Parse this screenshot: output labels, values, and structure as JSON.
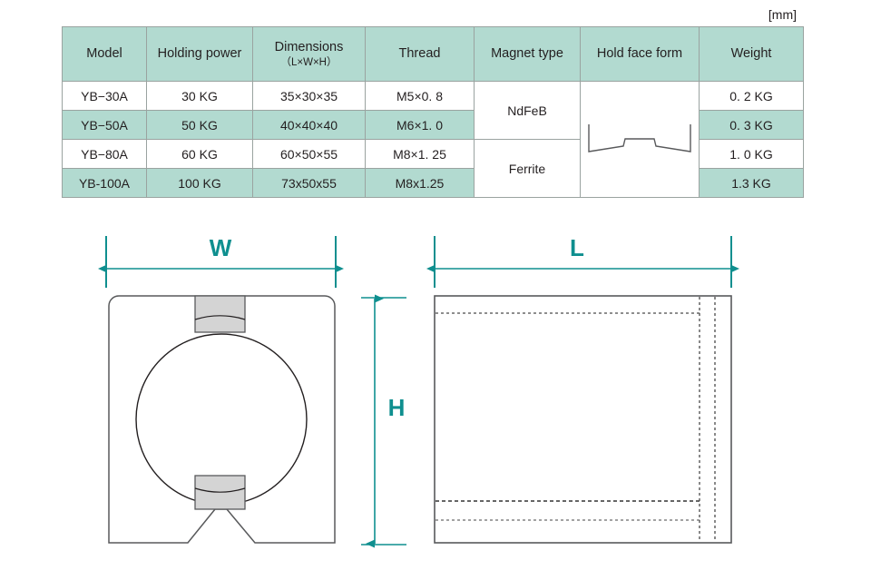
{
  "unit_note": "[mm]",
  "table": {
    "headers": [
      {
        "label": "Model",
        "sub": ""
      },
      {
        "label": "Holding power",
        "sub": ""
      },
      {
        "label": "Dimensions",
        "sub": "（L×W×H）"
      },
      {
        "label": "Thread",
        "sub": ""
      },
      {
        "label": "Magnet type",
        "sub": ""
      },
      {
        "label": "Hold face form",
        "sub": ""
      },
      {
        "label": "Weight",
        "sub": ""
      }
    ],
    "rows": [
      {
        "model": "YB−30A",
        "holding_power": "30 KG",
        "dimensions": "35×30×35",
        "thread": "M5×0. 8",
        "weight": "0. 2 KG",
        "tinted": false
      },
      {
        "model": "YB−50A",
        "holding_power": "50 KG",
        "dimensions": "40×40×40",
        "thread": "M6×1. 0",
        "weight": "0. 3 KG",
        "tinted": true
      },
      {
        "model": "YB−80A",
        "holding_power": "60 KG",
        "dimensions": "60×50×55",
        "thread": "M8×1. 25",
        "weight": "1. 0 KG",
        "tinted": false
      },
      {
        "model": "YB-100A",
        "holding_power": "100 KG",
        "dimensions": "73x50x55",
        "thread": "M8x1.25",
        "weight": "1.3 KG",
        "tinted": true
      }
    ],
    "magnet_types": [
      {
        "label": "NdFeB",
        "rowspan": 2
      },
      {
        "label": "Ferrite",
        "rowspan": 2
      }
    ],
    "hold_face_form": {
      "shape": "v-groove-profile",
      "rowspan": 4
    }
  },
  "drawings": {
    "front_view": {
      "name": "front-view-clamp",
      "dimension_width_label": "W",
      "dimension_height_label": "H"
    },
    "side_view": {
      "name": "side-view-clamp",
      "dimension_length_label": "L"
    }
  },
  "colors": {
    "header_green": "#b2dad0",
    "dimension_teal": "#0f8f8f",
    "outline_gray": "#58595b",
    "magnet_gray": "#d4d4d4",
    "table_border": "#9aa3a0"
  }
}
